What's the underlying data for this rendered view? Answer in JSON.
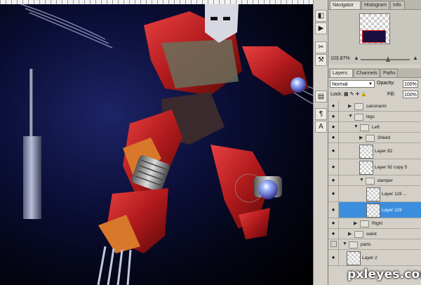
{
  "tool_icons": [
    "navigator-icon",
    "histogram-icon",
    "brush-settings-icon",
    "tool-presets-icon",
    "layers-icon",
    "paragraph-icon",
    "character-icon"
  ],
  "tool_glyphs": [
    "◧",
    "▶",
    "✂",
    "⚒",
    "▤",
    "¶",
    "A"
  ],
  "navigator_panel": {
    "tabs": [
      "Navigator",
      "Histogram",
      "Info"
    ],
    "zoom": "103.87%"
  },
  "layers_panel": {
    "tabs": [
      "Layers",
      "Channels",
      "Paths"
    ],
    "blend_mode": "Normal",
    "opacity_label": "Opacity:",
    "opacity": "100%",
    "lock_label": "Lock:",
    "fill_label": "Fill:",
    "fill": "100%",
    "rows": [
      {
        "label": "canonarm",
        "kind": "group"
      },
      {
        "label": "legs",
        "kind": "group"
      },
      {
        "label": "Left",
        "kind": "group"
      },
      {
        "label": "Shield",
        "kind": "group"
      },
      {
        "label": "Layer 82",
        "kind": "layer"
      },
      {
        "label": "Layer 92 copy 5",
        "kind": "layer"
      },
      {
        "label": "damper",
        "kind": "group"
      },
      {
        "label": "Layer 119 ...",
        "kind": "layer"
      },
      {
        "label": "Layer 119",
        "kind": "layer",
        "selected": true
      },
      {
        "label": "Right",
        "kind": "group"
      },
      {
        "label": "waist",
        "kind": "group"
      },
      {
        "label": "parts",
        "kind": "group"
      },
      {
        "label": "Layer 2",
        "kind": "layer"
      }
    ]
  },
  "watermark": "pxleyes.com",
  "colors": {
    "selection": "#3b8ede",
    "panel_bg": "#d4d0c8",
    "robot_red": "#c21e22"
  }
}
